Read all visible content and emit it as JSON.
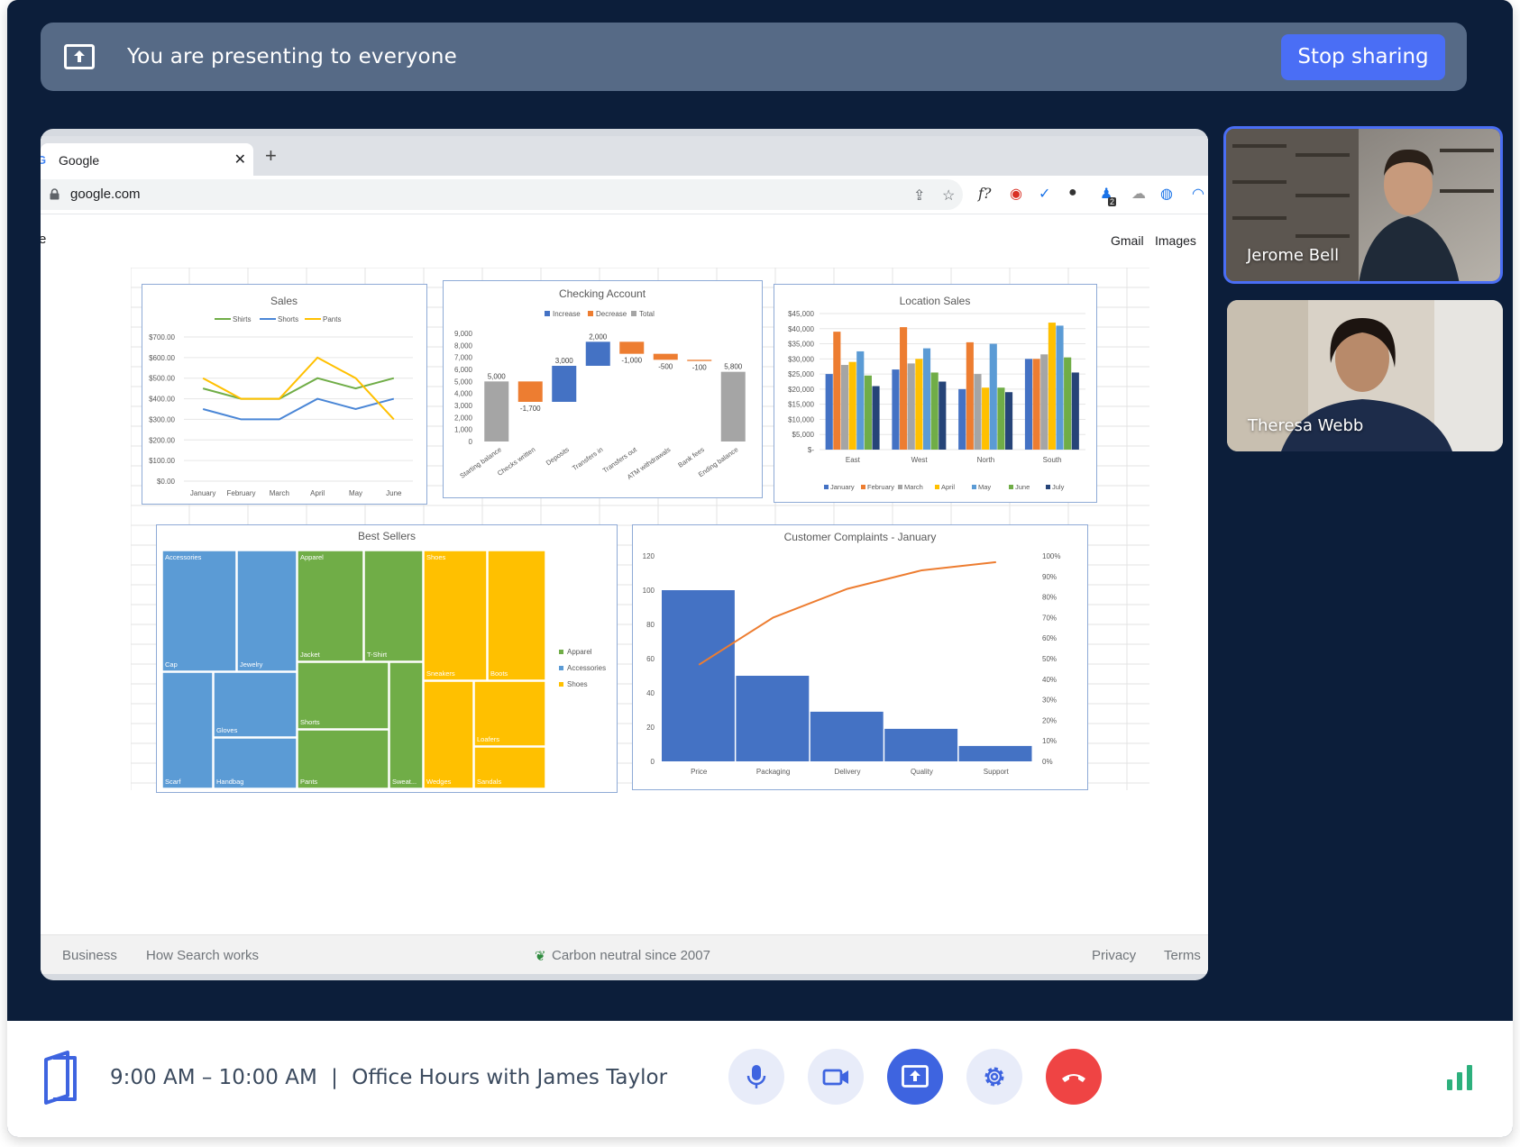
{
  "banner": {
    "text": "You are presenting to everyone",
    "stop_label": "Stop sharing",
    "icon": "present-screen-icon"
  },
  "browser": {
    "tab_title": "Google",
    "url": "google.com",
    "nav": {
      "gmail": "Gmail",
      "images": "Images"
    },
    "page_cut_char": "e",
    "footer": {
      "business": "Business",
      "how": "How Search works",
      "carbon": "Carbon neutral since 2007",
      "privacy": "Privacy",
      "terms": "Terms"
    },
    "ext_badge": "2",
    "ext_fx": "f?"
  },
  "participants": [
    {
      "name": "Jerome Bell"
    },
    {
      "name": "Theresa Webb"
    }
  ],
  "meeting": {
    "time": "9:00 AM – 10:00 AM",
    "separator": "|",
    "title": "Office Hours with James Taylor"
  },
  "controls": [
    {
      "name": "microphone-icon"
    },
    {
      "name": "camera-icon"
    },
    {
      "name": "present-screen-icon"
    },
    {
      "name": "gear-icon"
    },
    {
      "name": "end-call-icon"
    }
  ],
  "colors": {
    "stage": "#0c1e3a",
    "banner": "#566a86",
    "accent": "#4a6ef5",
    "end_call": "#ef4444",
    "signal": "#2db07d"
  },
  "chart_data": [
    {
      "type": "line",
      "title": "Sales",
      "categories": [
        "January",
        "February",
        "March",
        "April",
        "May",
        "June"
      ],
      "yticks": [
        "$700.00",
        "$600.00",
        "$500.00",
        "$400.00",
        "$300.00",
        "$200.00",
        "$100.00",
        "$0.00"
      ],
      "ylim": [
        0,
        700
      ],
      "series": [
        {
          "name": "Shirts",
          "color": "#70ad47",
          "values": [
            450,
            400,
            400,
            500,
            450,
            500
          ]
        },
        {
          "name": "Shorts",
          "color": "#4a86d6",
          "values": [
            350,
            300,
            300,
            400,
            350,
            400
          ]
        },
        {
          "name": "Pants",
          "color": "#ffc000",
          "values": [
            500,
            400,
            400,
            600,
            500,
            300
          ]
        }
      ]
    },
    {
      "type": "bar",
      "title": "Checking Account",
      "subtype": "waterfall",
      "legend": [
        {
          "name": "Increase",
          "color": "#4472c4"
        },
        {
          "name": "Decrease",
          "color": "#ed7d31"
        },
        {
          "name": "Total",
          "color": "#a5a5a5"
        }
      ],
      "categories": [
        "Starting balance",
        "Checks written",
        "Deposits",
        "Transfers in",
        "Transfers out",
        "ATM withdrawals",
        "Bank fees",
        "Ending balance"
      ],
      "values": [
        5000,
        -1700,
        3000,
        2000,
        -1000,
        -500,
        -100,
        5800
      ],
      "labels": [
        "5,000",
        "-1,700",
        "3,000",
        "2,000",
        "-1,000",
        "-500",
        "-100",
        "5,800"
      ],
      "yticks": [
        "9,000",
        "8,000",
        "7,000",
        "6,000",
        "5,000",
        "4,000",
        "3,000",
        "2,000",
        "1,000",
        "0"
      ],
      "ylim": [
        0,
        9000
      ]
    },
    {
      "type": "bar",
      "title": "Location Sales",
      "categories": [
        "East",
        "West",
        "North",
        "South"
      ],
      "yticks": [
        "$45,000",
        "$40,000",
        "$35,000",
        "$30,000",
        "$25,000",
        "$20,000",
        "$15,000",
        "$10,000",
        "$5,000",
        "$-"
      ],
      "ylim": [
        0,
        45000
      ],
      "series": [
        {
          "name": "January",
          "color": "#4472c4",
          "values": [
            25000,
            26500,
            20000,
            30000
          ]
        },
        {
          "name": "February",
          "color": "#ed7d31",
          "values": [
            39000,
            40500,
            35500,
            30000
          ]
        },
        {
          "name": "March",
          "color": "#a5a5a5",
          "values": [
            28000,
            28500,
            25000,
            31500
          ]
        },
        {
          "name": "April",
          "color": "#ffc000",
          "values": [
            29000,
            30000,
            20500,
            42000
          ]
        },
        {
          "name": "May",
          "color": "#5b9bd5",
          "values": [
            32500,
            33500,
            35000,
            41000
          ]
        },
        {
          "name": "June",
          "color": "#70ad47",
          "values": [
            24500,
            25500,
            20500,
            30500
          ]
        },
        {
          "name": "July",
          "color": "#264478",
          "values": [
            21000,
            22500,
            19000,
            25500
          ]
        }
      ]
    },
    {
      "type": "treemap",
      "title": "Best Sellers",
      "legend": [
        {
          "name": "Apparel",
          "color": "#70ad47"
        },
        {
          "name": "Accessories",
          "color": "#5b9bd5"
        },
        {
          "name": "Shoes",
          "color": "#ffc000"
        }
      ],
      "groups": [
        {
          "name": "Accessories",
          "items": [
            "Cap",
            "Jewelry",
            "Scarf",
            "Gloves",
            "Handbag"
          ]
        },
        {
          "name": "Apparel",
          "items": [
            "Jacket",
            "T-Shirt",
            "Shorts",
            "Pants",
            "Sweat..."
          ]
        },
        {
          "name": "Shoes",
          "items": [
            "Sneakers",
            "Boots",
            "Loafers",
            "Wedges",
            "Sandals"
          ]
        }
      ]
    },
    {
      "type": "bar",
      "title": "Customer Complaints - January",
      "subtype": "pareto",
      "categories": [
        "Price",
        "Packaging",
        "Delivery",
        "Quality",
        "Support"
      ],
      "values": [
        100,
        50,
        29,
        19,
        9
      ],
      "cumulative_percent": [
        47,
        70,
        84,
        93,
        97
      ],
      "yticks": [
        "120",
        "100",
        "80",
        "60",
        "40",
        "20",
        "0"
      ],
      "y2ticks": [
        "100%",
        "90%",
        "80%",
        "70%",
        "60%",
        "50%",
        "40%",
        "30%",
        "20%",
        "10%",
        "0%"
      ],
      "ylim": [
        0,
        120
      ],
      "y2lim": [
        0,
        100
      ]
    }
  ]
}
